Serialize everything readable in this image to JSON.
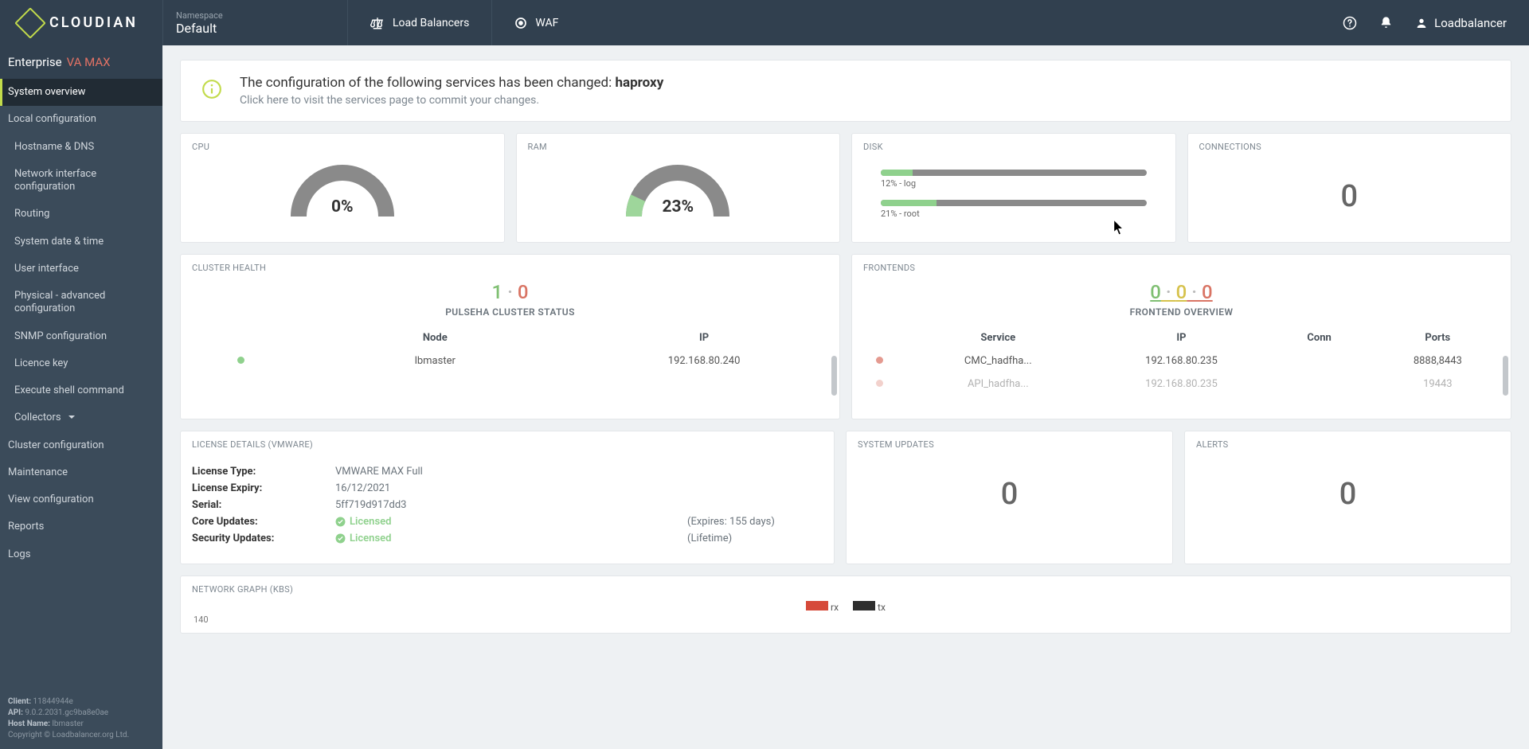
{
  "brand": "CLOUDIAN",
  "namespace": {
    "label": "Namespace",
    "value": "Default"
  },
  "topnav": {
    "lb": "Load Balancers",
    "waf": "WAF"
  },
  "user": "Loadbalancer",
  "product": {
    "enterprise": "Enterprise",
    "variant": "VA MAX"
  },
  "sidebar": {
    "systemOverview": "System overview",
    "localConfig": "Local configuration",
    "hostname": "Hostname & DNS",
    "nic": "Network interface configuration",
    "routing": "Routing",
    "datetime": "System date & time",
    "ui": "User interface",
    "physical": "Physical - advanced configuration",
    "snmp": "SNMP configuration",
    "licence": "Licence key",
    "shell": "Execute shell command",
    "collectors": "Collectors",
    "clusterConfig": "Cluster configuration",
    "maintenance": "Maintenance",
    "viewConfig": "View configuration",
    "reports": "Reports",
    "logs": "Logs"
  },
  "footer": {
    "clientKey": "Client:",
    "client": "11844944e",
    "apiKey": "API:",
    "api": "9.0.2.2031.gc9ba8e0ae",
    "hostKey": "Host Name:",
    "host": "lbmaster",
    "copyright": "Copyright © Loadbalancer.org Ltd."
  },
  "notice": {
    "line1a": "The configuration of the following services has been changed: ",
    "line1b": "haproxy",
    "line2": "Click here to visit the services page to commit your changes."
  },
  "cards": {
    "cpu": {
      "title": "CPU",
      "value": "0%",
      "pct": 0
    },
    "ram": {
      "title": "RAM",
      "value": "23%",
      "pct": 23
    },
    "disk": {
      "title": "DISK",
      "rows": [
        {
          "pct": 12,
          "label": "12% - log"
        },
        {
          "pct": 21,
          "label": "21% - root"
        }
      ]
    },
    "connections": {
      "title": "CONNECTIONS",
      "value": "0"
    }
  },
  "cluster": {
    "title": "CLUSTER HEALTH",
    "up": "1",
    "down": "0",
    "subtitle": "PULSEHA CLUSTER STATUS",
    "cols": {
      "node": "Node",
      "ip": "IP"
    },
    "rows": [
      {
        "status": "up",
        "node": "lbmaster",
        "ip": "192.168.80.240"
      }
    ]
  },
  "frontends": {
    "title": "FRONTENDS",
    "counters": {
      "a": "0",
      "b": "0",
      "c": "0"
    },
    "subtitle": "FRONTEND OVERVIEW",
    "cols": {
      "service": "Service",
      "ip": "IP",
      "conn": "Conn",
      "ports": "Ports"
    },
    "rows": [
      {
        "status": "down",
        "service": "CMC_hadfha...",
        "ip": "192.168.80.235",
        "conn": "",
        "ports": "8888,8443"
      },
      {
        "status": "down",
        "service": "API_hadfha...",
        "ip": "192.168.80.235",
        "conn": "",
        "ports": "19443"
      }
    ]
  },
  "license": {
    "title": "LICENSE DETAILS (VMWARE)",
    "type_k": "License Type:",
    "type_v": "VMWARE MAX Full",
    "expiry_k": "License Expiry:",
    "expiry_v": "16/12/2021",
    "serial_k": "Serial:",
    "serial_v": "5ff719d917dd3",
    "core_k": "Core Updates:",
    "core_v": "Licensed",
    "core_note": "(Expires: 155 days)",
    "sec_k": "Security Updates:",
    "sec_v": "Licensed",
    "sec_note": "(Lifetime)"
  },
  "updates": {
    "title": "SYSTEM UPDATES",
    "value": "0"
  },
  "alerts": {
    "title": "ALERTS",
    "value": "0"
  },
  "network": {
    "title": "NETWORK GRAPH (KBS)",
    "legend_rx": "rx",
    "legend_tx": "tx",
    "y_tick": "140"
  },
  "chart_data": [
    {
      "type": "bar",
      "title": "CPU",
      "categories": [
        "cpu"
      ],
      "values": [
        0
      ],
      "ylim": [
        0,
        100
      ]
    },
    {
      "type": "bar",
      "title": "RAM",
      "categories": [
        "ram"
      ],
      "values": [
        23
      ],
      "ylim": [
        0,
        100
      ]
    },
    {
      "type": "bar",
      "title": "Disk",
      "categories": [
        "log",
        "root"
      ],
      "values": [
        12,
        21
      ],
      "ylim": [
        0,
        100
      ]
    },
    {
      "type": "line",
      "title": "Network Graph (KBs)",
      "series": [
        {
          "name": "rx",
          "values": []
        },
        {
          "name": "tx",
          "values": []
        }
      ],
      "ylim": [
        0,
        140
      ],
      "ylabel": "KBs"
    }
  ]
}
